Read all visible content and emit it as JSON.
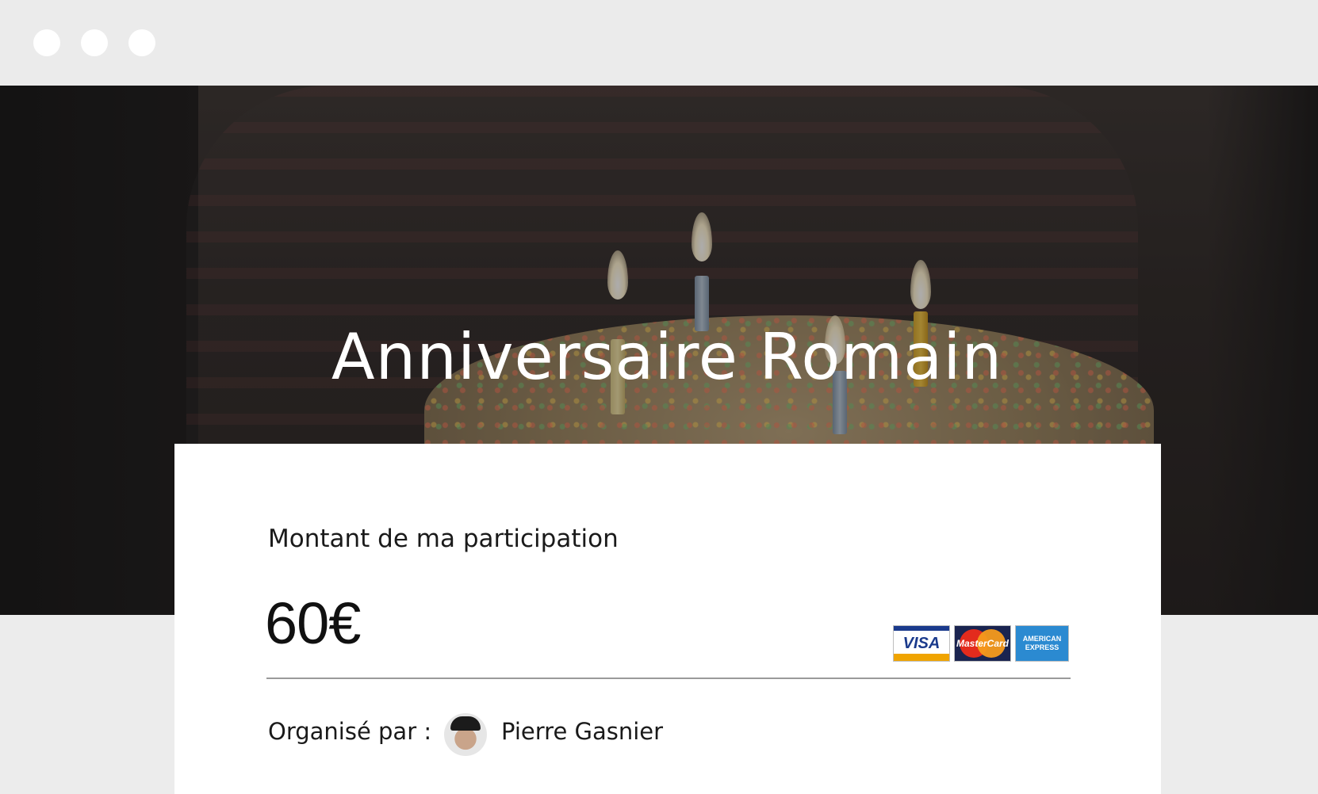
{
  "hero": {
    "title": "Anniversaire Romain"
  },
  "payment": {
    "label": "Montant de ma participation",
    "amount": "60€",
    "card_logos": [
      "VISA",
      "MasterCard",
      "AMERICAN EXPRESS"
    ]
  },
  "organizer": {
    "label": "Organisé par :",
    "name": "Pierre Gasnier"
  }
}
